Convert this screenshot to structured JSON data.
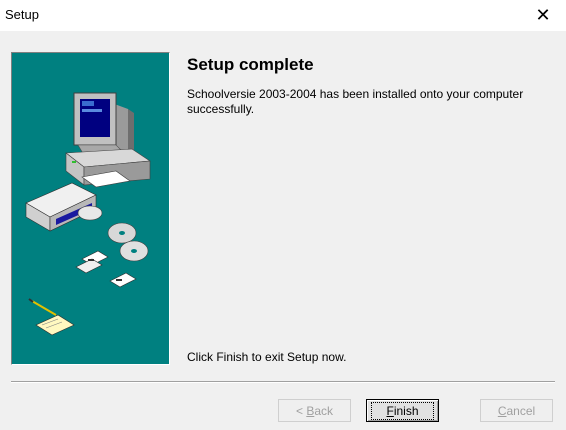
{
  "window": {
    "title": "Setup",
    "close_glyph": "✕",
    "close_icon": "close-icon"
  },
  "content": {
    "heading": "Setup complete",
    "message": "Schoolversie 2003-2004 has been installed onto your computer successfully.",
    "footer": "Click Finish to exit Setup now."
  },
  "side_panel": {
    "background_color": "#008080",
    "illustration_icon": "computer-with-disks-illustration"
  },
  "buttons": {
    "back": {
      "prefix": "< ",
      "accel": "B",
      "rest": "ack",
      "enabled": false
    },
    "finish": {
      "accel": "F",
      "rest": "inish",
      "enabled": true,
      "default": true
    },
    "cancel": {
      "accel": "C",
      "rest": "ancel",
      "enabled": false
    }
  }
}
